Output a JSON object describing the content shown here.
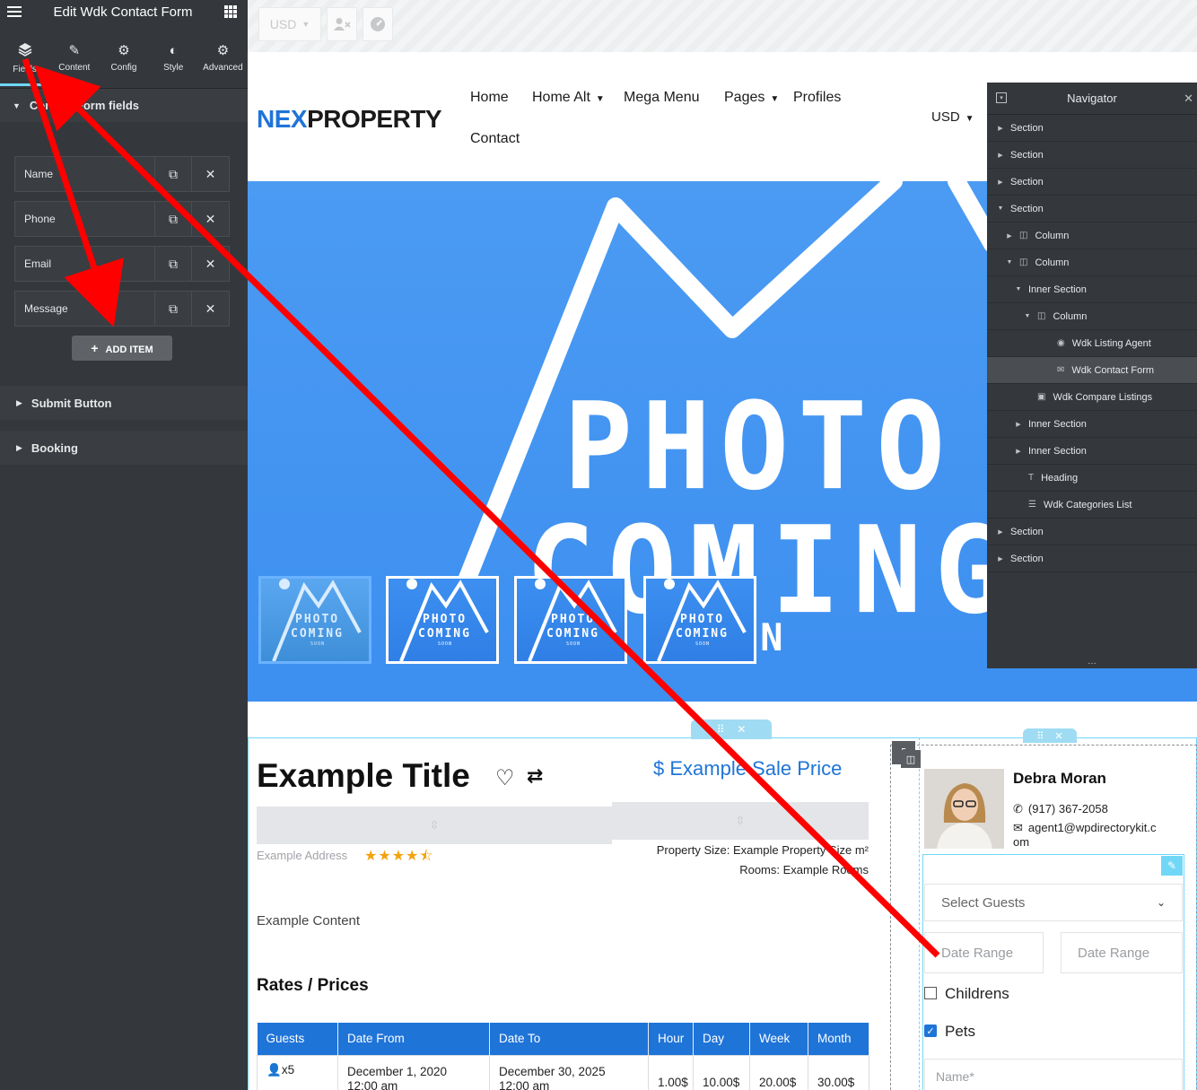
{
  "panel": {
    "title": "Edit Wdk Contact Form",
    "tabs": [
      {
        "label": "Fields",
        "icon": "layers-icon"
      },
      {
        "label": "Content",
        "icon": "pencil-icon"
      },
      {
        "label": "Config",
        "icon": "gears-icon"
      },
      {
        "label": "Style",
        "icon": "contrast-icon"
      },
      {
        "label": "Advanced",
        "icon": "gear-icon"
      }
    ],
    "section_title": "Contact Form fields",
    "fields": [
      "Name",
      "Phone",
      "Email",
      "Message"
    ],
    "add_item": "ADD ITEM",
    "groups": [
      "Submit Button",
      "Booking"
    ]
  },
  "topbar": {
    "currency": "USD"
  },
  "header": {
    "logo_a": "NEX",
    "logo_b": "PROPERTY",
    "nav": [
      "Home",
      "Home Alt",
      "Mega Menu",
      "Pages",
      "Profiles",
      "Contact"
    ],
    "currency": "USD"
  },
  "hero": {
    "text1": "PHOTO",
    "text2": "COMING",
    "text3": "ON",
    "thumb_text1": "PHOTO",
    "thumb_text2": "COMING",
    "thumb_text3": "SOON"
  },
  "listing": {
    "title": "Example Title",
    "price": "$ Example Sale Price",
    "address": "Example Address",
    "rating": 4.5,
    "property_size_label": "Property Size:",
    "property_size_value": "Example Property Size m²",
    "rooms_label": "Rooms:",
    "rooms_value": "Example Rooms",
    "content": "Example Content",
    "rates_heading": "Rates / Prices",
    "rates_headers": [
      "Guests",
      "Date From",
      "Date To",
      "Hour",
      "Day",
      "Week",
      "Month"
    ],
    "rates_row": [
      "x5",
      "December 1, 2020",
      "December 30, 2025",
      "1.00$",
      "10.00$",
      "20.00$",
      "30.00$"
    ],
    "rates_row_extra": [
      "12:00 am",
      "12:00 am"
    ]
  },
  "agent": {
    "name": "Debra Moran",
    "phone": "(917) 367-2058",
    "email_line1": "agent1@wpdirectorykit.c",
    "email_line2": "om"
  },
  "form": {
    "select_guests": "Select Guests",
    "date_range_1": "Date Range",
    "date_range_2": "Date Range",
    "childrens": "Childrens",
    "pets": "Pets",
    "name_placeholder": "Name*"
  },
  "navigator": {
    "title": "Navigator",
    "items": [
      {
        "label": "Section",
        "level": 0,
        "caret": "right"
      },
      {
        "label": "Section",
        "level": 0,
        "caret": "right"
      },
      {
        "label": "Section",
        "level": 0,
        "caret": "right"
      },
      {
        "label": "Section",
        "level": 0,
        "caret": "down"
      },
      {
        "label": "Column",
        "level": 1,
        "caret": "right",
        "icon": "column-icon"
      },
      {
        "label": "Column",
        "level": 1,
        "caret": "down",
        "icon": "column-icon"
      },
      {
        "label": "Inner Section",
        "level": 2,
        "caret": "down"
      },
      {
        "label": "Column",
        "level": 3,
        "caret": "down",
        "icon": "column-icon"
      },
      {
        "label": "Wdk Listing Agent",
        "level": 4,
        "icon": "agent-icon"
      },
      {
        "label": "Wdk Contact Form",
        "level": 4,
        "icon": "mail-icon",
        "selected": true
      },
      {
        "label": "Wdk Compare Listings",
        "level": 3,
        "icon": "compare-icon"
      },
      {
        "label": "Inner Section",
        "level": 2,
        "caret": "right"
      },
      {
        "label": "Inner Section",
        "level": 2,
        "caret": "right"
      },
      {
        "label": "Heading",
        "level": 2,
        "icon": "heading-icon"
      },
      {
        "label": "Wdk Categories List",
        "level": 2,
        "icon": "list-icon"
      },
      {
        "label": "Section",
        "level": 0,
        "caret": "right"
      },
      {
        "label": "Section",
        "level": 0,
        "caret": "right"
      }
    ]
  },
  "colors": {
    "accent": "#1f74d8",
    "panel": "#34383c",
    "arrow": "#ff0000",
    "selection": "#71d7f7"
  }
}
